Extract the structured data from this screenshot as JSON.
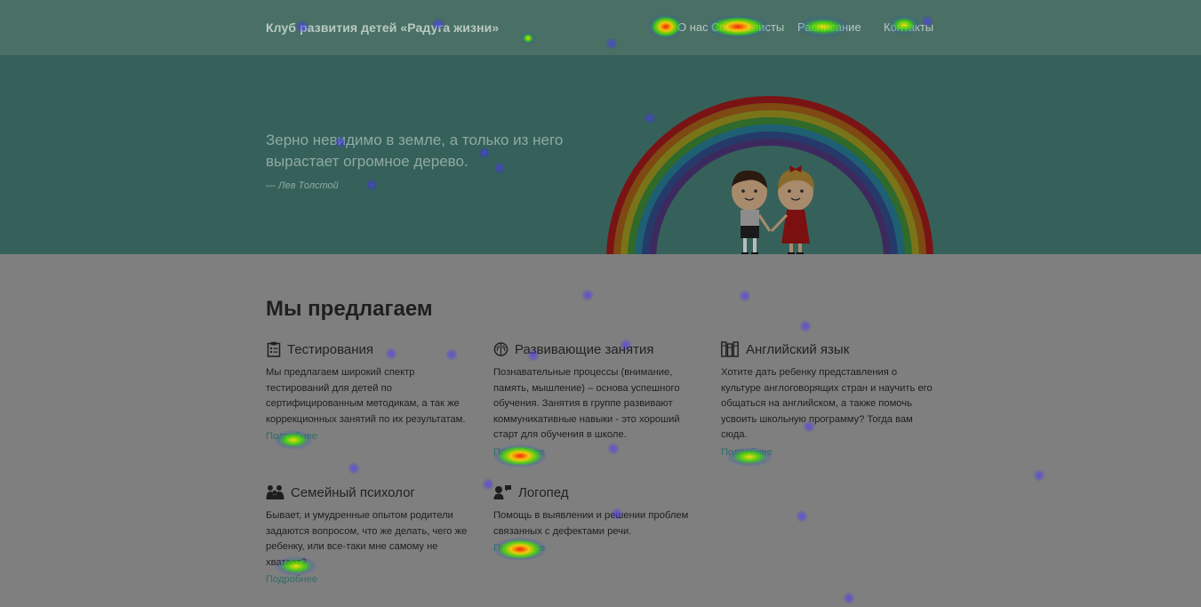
{
  "header": {
    "brand": "Клуб развития детей «Радуга жизни»",
    "nav": [
      {
        "label": "О нас"
      },
      {
        "label": "Специалисты"
      },
      {
        "label": "Расписание"
      },
      {
        "label": "Контакты"
      }
    ]
  },
  "hero": {
    "quote": "Зерно невидимо в земле, а только из него вырастает огромное дерево.",
    "author": "— Лев Толстой"
  },
  "offers": {
    "title": "Мы предлагаем",
    "cards": [
      {
        "title": "Тестирования",
        "icon": "clipboard-icon",
        "text": "Мы предлагаем широкий спектр тестирований для детей по сертифицированным методикам, а так же коррекционных занятий по их результатам.",
        "more": "Подробнее"
      },
      {
        "title": "Развивающие занятия",
        "icon": "brain-icon",
        "text": "Познавательные процессы (внимание, память, мышление) – основа успешного обучения. Занятия в группе развивают коммуникативные навыки - это хороший старт для обучения в школе.",
        "more": "Подробнее"
      },
      {
        "title": "Английский язык",
        "icon": "books-icon",
        "text": "Хотите дать ребенку представления о культуре англоговорящих стран и научить его общаться на английском, а также помочь усвоить школьную программу? Тогда вам сюда.",
        "more": "Подробнее"
      },
      {
        "title": "Семейный психолог",
        "icon": "family-icon",
        "text": "Бывает, и умудренные опытом родители задаются вопросом, что же делать, чего же ребенку, или все-таки мне самому не хватает?",
        "more": "Подробнее"
      },
      {
        "title": "Логопед",
        "icon": "speech-therapist-icon",
        "text": "Помощь в выявлении и решении проблем связанных с дефектами речи.",
        "more": "Подробнее"
      }
    ]
  },
  "colors": {
    "navbar": "#4a7065",
    "hero": "#36615b",
    "page": "#7f7f7f",
    "link": "#2f6e63"
  }
}
